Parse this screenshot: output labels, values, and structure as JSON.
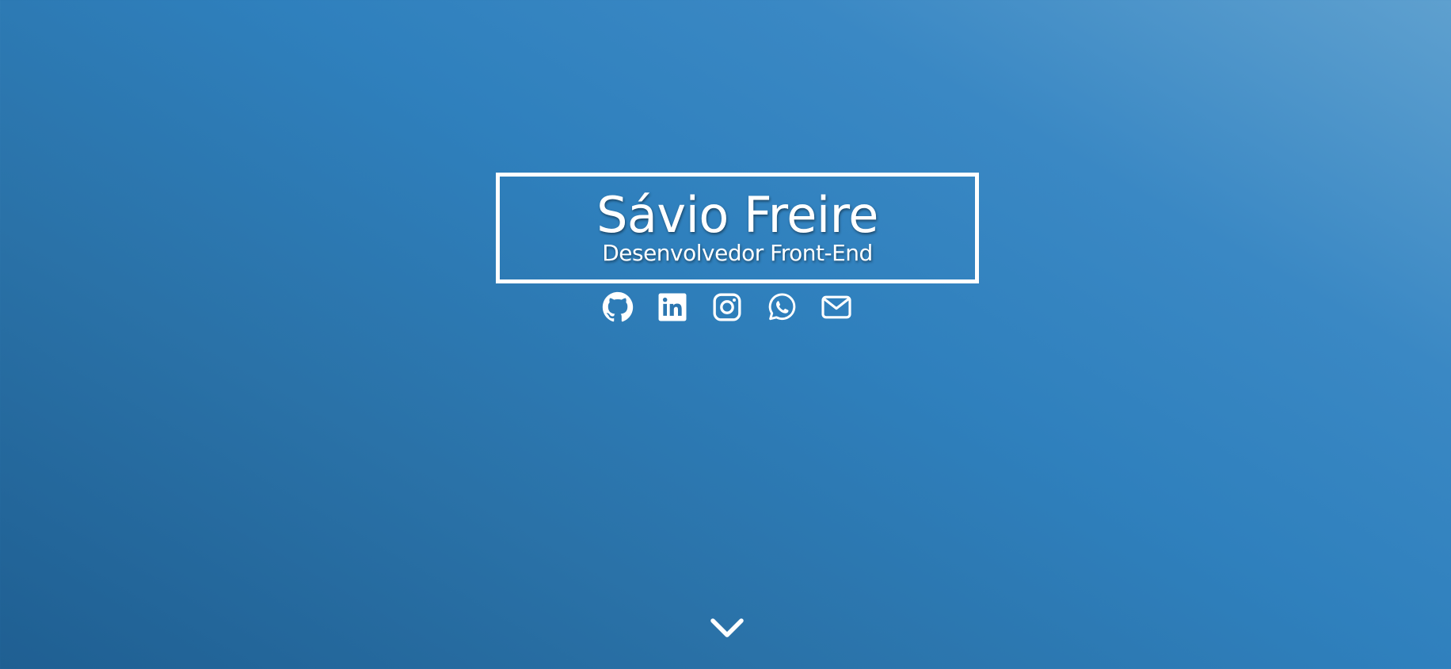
{
  "header": {
    "name": "Sávio Freire",
    "role": "Desenvolvedor Front-End"
  },
  "social": {
    "links": [
      {
        "icon": "github-icon",
        "label": "GitHub"
      },
      {
        "icon": "linkedin-icon",
        "label": "LinkedIn"
      },
      {
        "icon": "instagram-icon",
        "label": "Instagram"
      },
      {
        "icon": "whatsapp-icon",
        "label": "WhatsApp"
      },
      {
        "icon": "email-icon",
        "label": "E-mail"
      }
    ]
  },
  "scroll": {
    "icon": "chevron-down-icon"
  },
  "colors": {
    "text": "#ffffff",
    "background_start": "#1f5f92",
    "background_mid": "#2f80bd",
    "background_end": "#5ea0cf"
  }
}
